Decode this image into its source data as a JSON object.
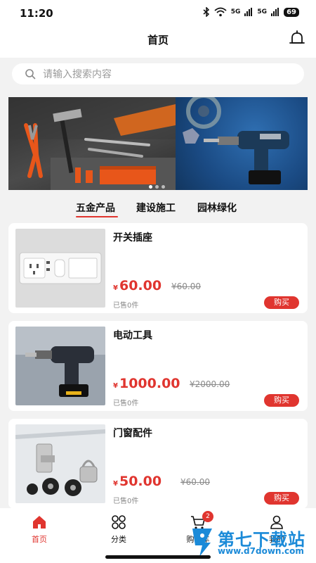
{
  "status": {
    "time": "11:20",
    "battery": "69",
    "signal1": "5G",
    "signal2": "5G"
  },
  "nav": {
    "title": "首页"
  },
  "search": {
    "placeholder": "请输入搜索内容"
  },
  "tabs": [
    {
      "label": "五金产品",
      "active": true
    },
    {
      "label": "建设施工",
      "active": false
    },
    {
      "label": "园林绿化",
      "active": false
    }
  ],
  "products": [
    {
      "title": "开关插座",
      "currency": "¥",
      "price": "60.00",
      "orig_price": "¥60.00",
      "sold": "已售0件",
      "buy_label": "购买"
    },
    {
      "title": "电动工具",
      "currency": "¥",
      "price": "1000.00",
      "orig_price": "¥2000.00",
      "sold": "已售0件",
      "buy_label": "购买"
    },
    {
      "title": "门窗配件",
      "currency": "¥",
      "price": "50.00",
      "orig_price": "¥60.00",
      "sold": "已售0件",
      "buy_label": "购买"
    }
  ],
  "bottom_nav": [
    {
      "label": "首页",
      "icon": "home-icon",
      "active": true
    },
    {
      "label": "分类",
      "icon": "grid-icon",
      "active": false
    },
    {
      "label": "购物车",
      "icon": "cart-icon",
      "active": false,
      "badge": "2"
    },
    {
      "label": "我的",
      "icon": "user-icon",
      "active": false
    }
  ],
  "watermark": {
    "brand": "第七下载站",
    "url": "www.d7down.com"
  },
  "colors": {
    "accent": "#e0352f",
    "watermark": "#1b8ad8"
  }
}
